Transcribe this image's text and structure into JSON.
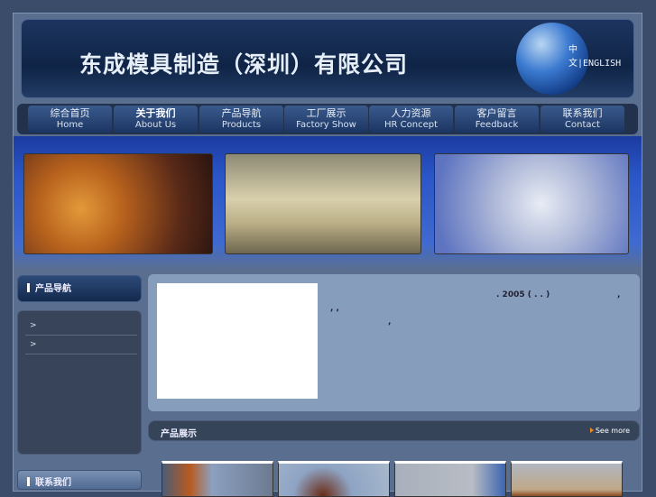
{
  "header": {
    "title": "东成模具制造（深圳）有限公司",
    "lang_cn": "中 文",
    "lang_sep": "|",
    "lang_en": "ENGLISH"
  },
  "nav": [
    {
      "cn": "综合首页",
      "en": "Home"
    },
    {
      "cn": "关于我们",
      "en": "About Us"
    },
    {
      "cn": "产品导航",
      "en": "Products"
    },
    {
      "cn": "工厂展示",
      "en": "Factory Show"
    },
    {
      "cn": "人力资源",
      "en": "HR Concept"
    },
    {
      "cn": "客户留言",
      "en": "Feedback"
    },
    {
      "cn": "联系我们",
      "en": "Contact"
    }
  ],
  "sidebar": {
    "product_nav": "产品导航",
    "items": [
      ">",
      ">"
    ],
    "contact": "联系我们"
  },
  "intro": {
    "line1": ". 2005  ( . . )",
    "comma1": ",",
    "line2": ", ,",
    "comma2": ","
  },
  "products": {
    "title": "产品展示",
    "see_more": "See more"
  },
  "colors": {
    "accent": "#f08a1c",
    "content_bg": "#879dbc"
  }
}
